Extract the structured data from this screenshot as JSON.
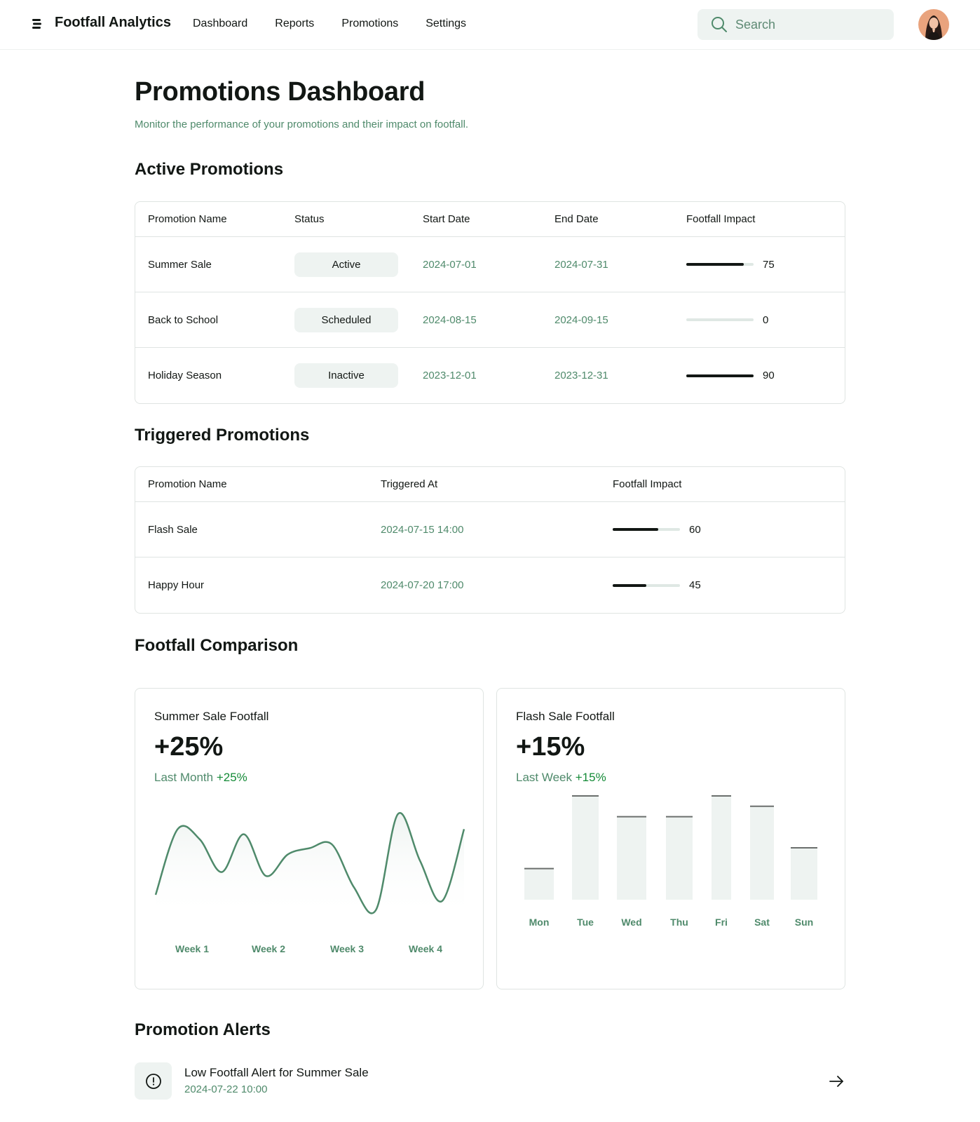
{
  "app": {
    "title": "Footfall Analytics"
  },
  "nav": {
    "items": [
      "Dashboard",
      "Reports",
      "Promotions",
      "Settings"
    ]
  },
  "search": {
    "placeholder": "Search"
  },
  "page": {
    "title": "Promotions Dashboard",
    "subtitle": "Monitor the performance of your promotions and their impact on footfall."
  },
  "active_promotions": {
    "title": "Active Promotions",
    "columns": [
      "Promotion Name",
      "Status",
      "Start Date",
      "End Date",
      "Footfall Impact"
    ],
    "rows": [
      {
        "name": "Summer Sale",
        "status": "Active",
        "start": "2024-07-01",
        "end": "2024-07-31",
        "impact": "75"
      },
      {
        "name": "Back to School",
        "status": "Scheduled",
        "start": "2024-08-15",
        "end": "2024-09-15",
        "impact": "0"
      },
      {
        "name": "Holiday Season",
        "status": "Inactive",
        "start": "2023-12-01",
        "end": "2023-12-31",
        "impact": "90"
      }
    ]
  },
  "triggered_promotions": {
    "title": "Triggered Promotions",
    "columns": [
      "Promotion Name",
      "Triggered At",
      "Footfall Impact"
    ],
    "rows": [
      {
        "name": "Flash Sale",
        "triggered_at": "2024-07-15 14:00",
        "impact": "60"
      },
      {
        "name": "Happy Hour",
        "triggered_at": "2024-07-20 17:00",
        "impact": "45"
      }
    ]
  },
  "footfall_comparison": {
    "title": "Footfall Comparison",
    "cards": [
      {
        "title": "Summer Sale Footfall",
        "value": "+25%",
        "period": "Last Month",
        "change": "+25%"
      },
      {
        "title": "Flash Sale Footfall",
        "value": "+15%",
        "period": "Last Week",
        "change": "+15%"
      }
    ]
  },
  "chart_data": [
    {
      "type": "line",
      "title": "Summer Sale Footfall",
      "x_ticks": [
        "Week 1",
        "Week 2",
        "Week 3",
        "Week 4"
      ],
      "y": [
        20,
        72,
        64,
        38,
        68,
        35,
        52,
        57,
        60,
        26,
        8,
        84,
        47,
        15,
        72
      ],
      "color": "#4f8a6b",
      "axes_values_shown": false
    },
    {
      "type": "bar",
      "title": "Flash Sale Footfall",
      "categories": [
        "Mon",
        "Tue",
        "Wed",
        "Thu",
        "Fri",
        "Sat",
        "Sun"
      ],
      "values": [
        30,
        100,
        80,
        80,
        100,
        90,
        50
      ],
      "color": "#eef3f1",
      "axes_values_shown": false
    }
  ],
  "alerts": {
    "title": "Promotion Alerts",
    "items": [
      {
        "title": "Low Footfall Alert for Summer Sale",
        "time": "2024-07-22 10:00"
      }
    ]
  },
  "colors": {
    "accent": "#4f8a6b",
    "positive": "#138a36",
    "surface": "#eef3f1",
    "border": "#dfe4e2"
  }
}
